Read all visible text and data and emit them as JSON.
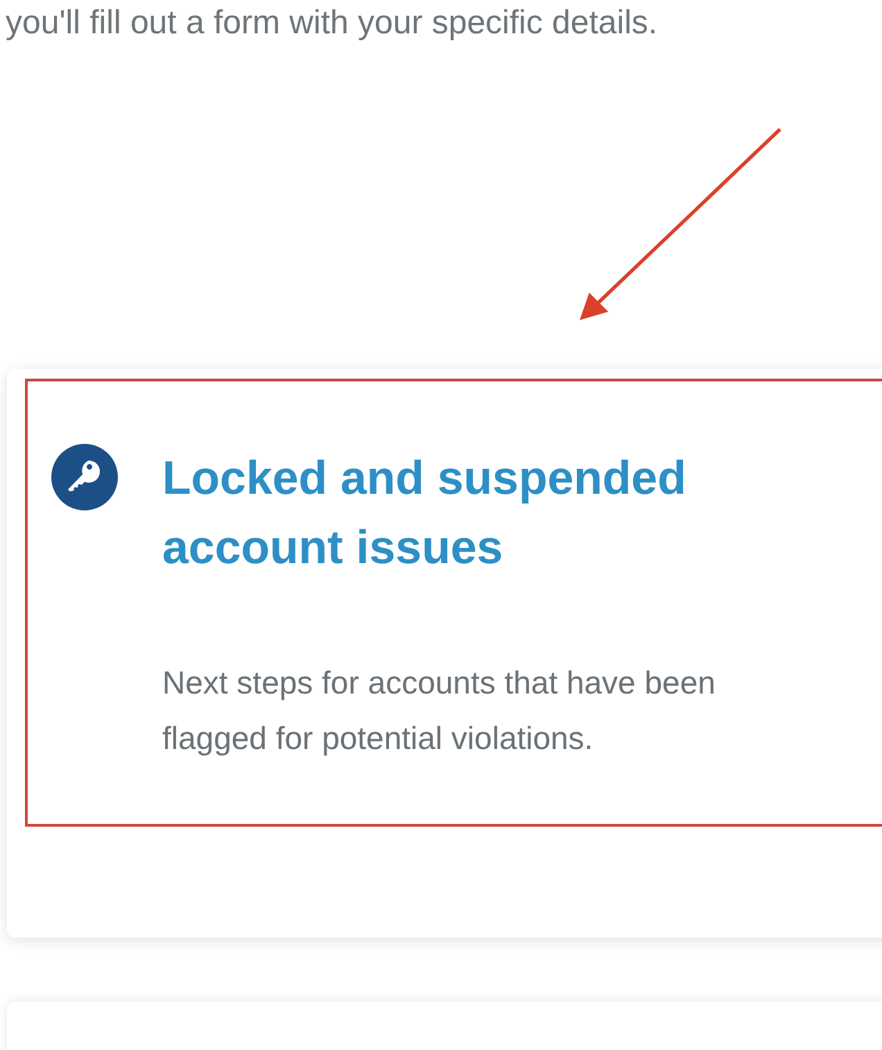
{
  "intro_text": "you'll fill out a form with your specific details.",
  "cards": [
    {
      "title": "Locked and suspended account issues",
      "description": "Next steps for accounts that have been flagged for potential violations.",
      "highlighted": true
    }
  ]
}
